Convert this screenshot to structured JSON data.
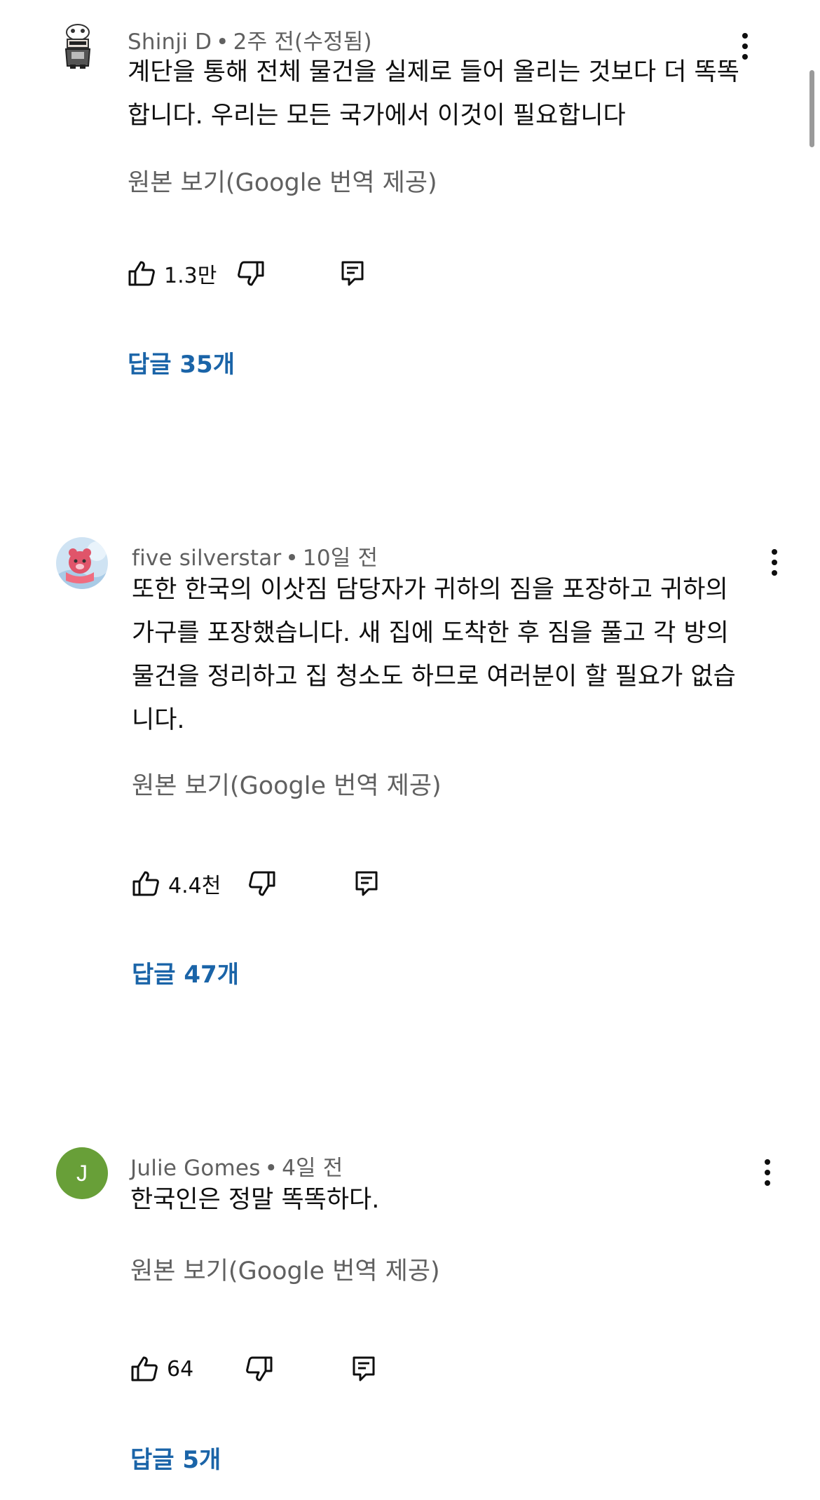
{
  "comments": [
    {
      "author": "Shinji D",
      "time": "2주 전(수정됨)",
      "text": "계단을 통해 전체 물건을 실제로 들어 올리는 것보다 더 똑똑\n합니다. 우리는 모든 국가에서 이것이 필요합니다",
      "translate_label": "원본 보기(Google 번역 제공)",
      "likes": "1.3만",
      "replies_label": "답글 35개"
    },
    {
      "author": "five silverstar",
      "time": "10일 전",
      "text": "또한 한국의 이삿짐 담당자가 귀하의 짐을 포장하고 귀하의\n가구를 포장했습니다. 새 집에 도착한 후 짐을 풀고 각 방의\n물건을 정리하고 집 청소도 하므로 여러분이 할 필요가 없습\n니다.",
      "translate_label": "원본 보기(Google 번역 제공)",
      "likes": "4.4천",
      "replies_label": "답글 47개"
    },
    {
      "author": "Julie Gomes",
      "time": "4일 전",
      "avatar_letter": "J",
      "text": "한국인은 정말 똑똑하다.",
      "translate_label": "원본 보기(Google 번역 제공)",
      "likes": "64",
      "replies_label": "답글 5개"
    }
  ],
  "separator": "•",
  "icons": {
    "like": "thumbs-up-icon",
    "dislike": "thumbs-down-icon",
    "reply": "comment-icon",
    "more": "more-vert-icon"
  },
  "colors": {
    "replies": "#1a64a8",
    "meta": "#606060",
    "letter_avatar": "#689f38"
  }
}
